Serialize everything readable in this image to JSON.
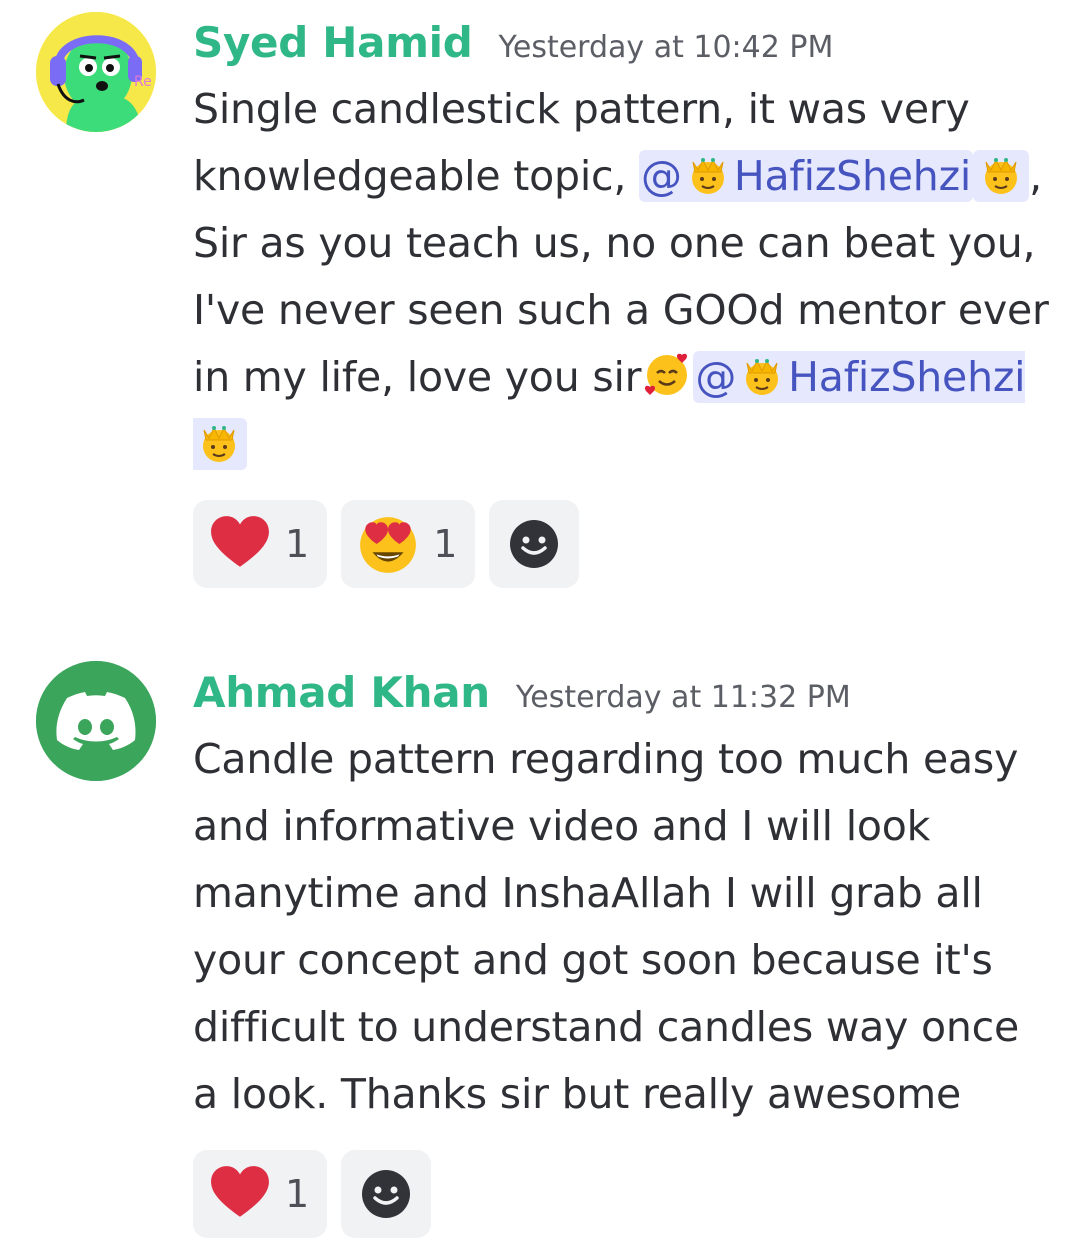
{
  "messages": [
    {
      "username": "Syed Hamid",
      "timestamp": "Yesterday at 10:42 PM",
      "avatar": "cartoon-headset-avatar",
      "content": {
        "text_1": "Single candlestick pattern, it was very knowledgeable topic, ",
        "mention_1": "@",
        "mention_1_name": "HafizShehzi",
        "text_2": ", Sir as you teach us, no one can beat you, I've never seen such a GOOd mentor ever in my life, love you sir",
        "mention_2": "@",
        "mention_2_name": "HafizShehzi"
      },
      "reactions": [
        {
          "emoji": "red-heart-icon",
          "count": "1"
        },
        {
          "emoji": "heart-eyes-face-icon",
          "count": "1"
        }
      ]
    },
    {
      "username": "Ahmad Khan",
      "timestamp": "Yesterday at 11:32 PM",
      "avatar": "discord-default-avatar",
      "content": {
        "text_1": "Candle pattern regarding too much easy and informative video and I will look manytime and InshaAllah I will grab all your concept and got soon because it's difficult to understand candles way once a look. Thanks sir but really awesome"
      },
      "reactions": [
        {
          "emoji": "red-heart-icon",
          "count": "1"
        }
      ]
    }
  ],
  "colors": {
    "username": "#2fb787",
    "mention_bg": "#e6e8fd",
    "mention_text": "#4654c0",
    "reaction_bg": "#f1f2f4",
    "discord_green": "#3ba55c"
  }
}
